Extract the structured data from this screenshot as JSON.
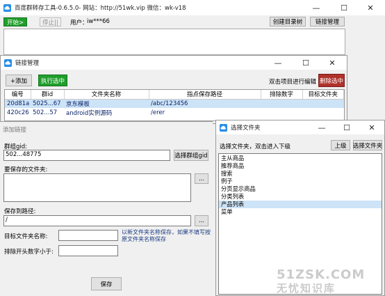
{
  "main": {
    "title": "百度群转存工具-0.6.5.0- 网站：http://51wk.vip 微信：wk-v18",
    "start_label": "开始>",
    "stop_label": "停止||",
    "user_label": "用户：",
    "user_value": "iw***66",
    "create_tree_label": "创建目录树",
    "link_mgr_label": "链接管理"
  },
  "link_manager": {
    "title": "链接管理",
    "add_label": "+添加",
    "exec_label": "执行选中",
    "hint": "双击项目进行编辑",
    "delete_label": "删除选中",
    "columns": [
      "编号",
      "群id",
      "文件夹名称",
      "指点保存路径",
      "排除数字",
      "目标文件夹"
    ],
    "rows": [
      {
        "id": "20d81a",
        "gid": "5025...67",
        "folder": "京东模板",
        "path": "/abc/123456",
        "exclude": "",
        "target": ""
      },
      {
        "id": "420c26",
        "gid": "502...57",
        "folder": "android实例源码",
        "path": "/erer",
        "exclude": "",
        "target": ""
      }
    ]
  },
  "add_link": {
    "title": "添加链接",
    "gid_label": "群组gid:",
    "gid_value": "502...48775",
    "select_group_label": "选择群组gid",
    "folder_label": "要保存的文件夹:",
    "folder_value": "",
    "browse_label": "...",
    "save_path_label": "保存到路径:",
    "save_path_value": "/",
    "target_name_label": "目标文件夹名称:",
    "target_name_value": "",
    "target_hint": "以新文件夹名称保存，如果不填写按原文件夹名称保存",
    "exclude_label": "排除开头数字小于:",
    "exclude_value": "",
    "save_label": "保存"
  },
  "folder_select": {
    "title": "选择文件夹",
    "hint": "选择文件夹，双击进入下级",
    "up_label": "上级",
    "select_label": "选择文件夹",
    "items": [
      "主从商品",
      "推荐商品",
      "搜索",
      "例子",
      "分页显示商品",
      "分类列表",
      "产品列表",
      "菜单"
    ],
    "selected_index": 6
  },
  "watermark": {
    "line1": "51ZSK.COM",
    "line2": "无忧知识库"
  },
  "colors": {
    "accent_green": "#1f9e2b",
    "delete_red": "#b0312b",
    "selection": "#cde3f7",
    "app_icon_blue": "#2a8ee6"
  }
}
